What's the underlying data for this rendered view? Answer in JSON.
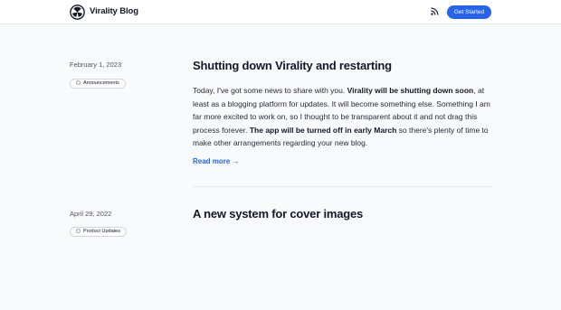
{
  "header": {
    "brand": "Virality Blog",
    "logo_icon": "triskelion-logo-icon",
    "rss_icon": "rss-icon",
    "cta_label": "Get Started"
  },
  "posts": [
    {
      "date": "February 1, 2023",
      "tag": "Announcements",
      "title": "Shutting down Virality and restarting",
      "excerpt": [
        {
          "text": "Today, I've got some news to share with you. ",
          "bold": false
        },
        {
          "text": "Virality will be shutting down soon",
          "bold": true
        },
        {
          "text": ", at least as a blogging platform for updates. It will become something else. Something I am far more excited to work on, so I thought to be transparent about it and not drag this process forever. ",
          "bold": false
        },
        {
          "text": "The app will be turned off in early March",
          "bold": true
        },
        {
          "text": " so there's plenty of time to make other arrangements regarding your new blog.",
          "bold": false
        }
      ],
      "read_more": "Read more →"
    },
    {
      "date": "April 29, 2022",
      "tag": "Product Updates",
      "title": "A new system for cover images"
    }
  ],
  "colors": {
    "accent": "#2563eb",
    "background": "#f9fafb"
  }
}
